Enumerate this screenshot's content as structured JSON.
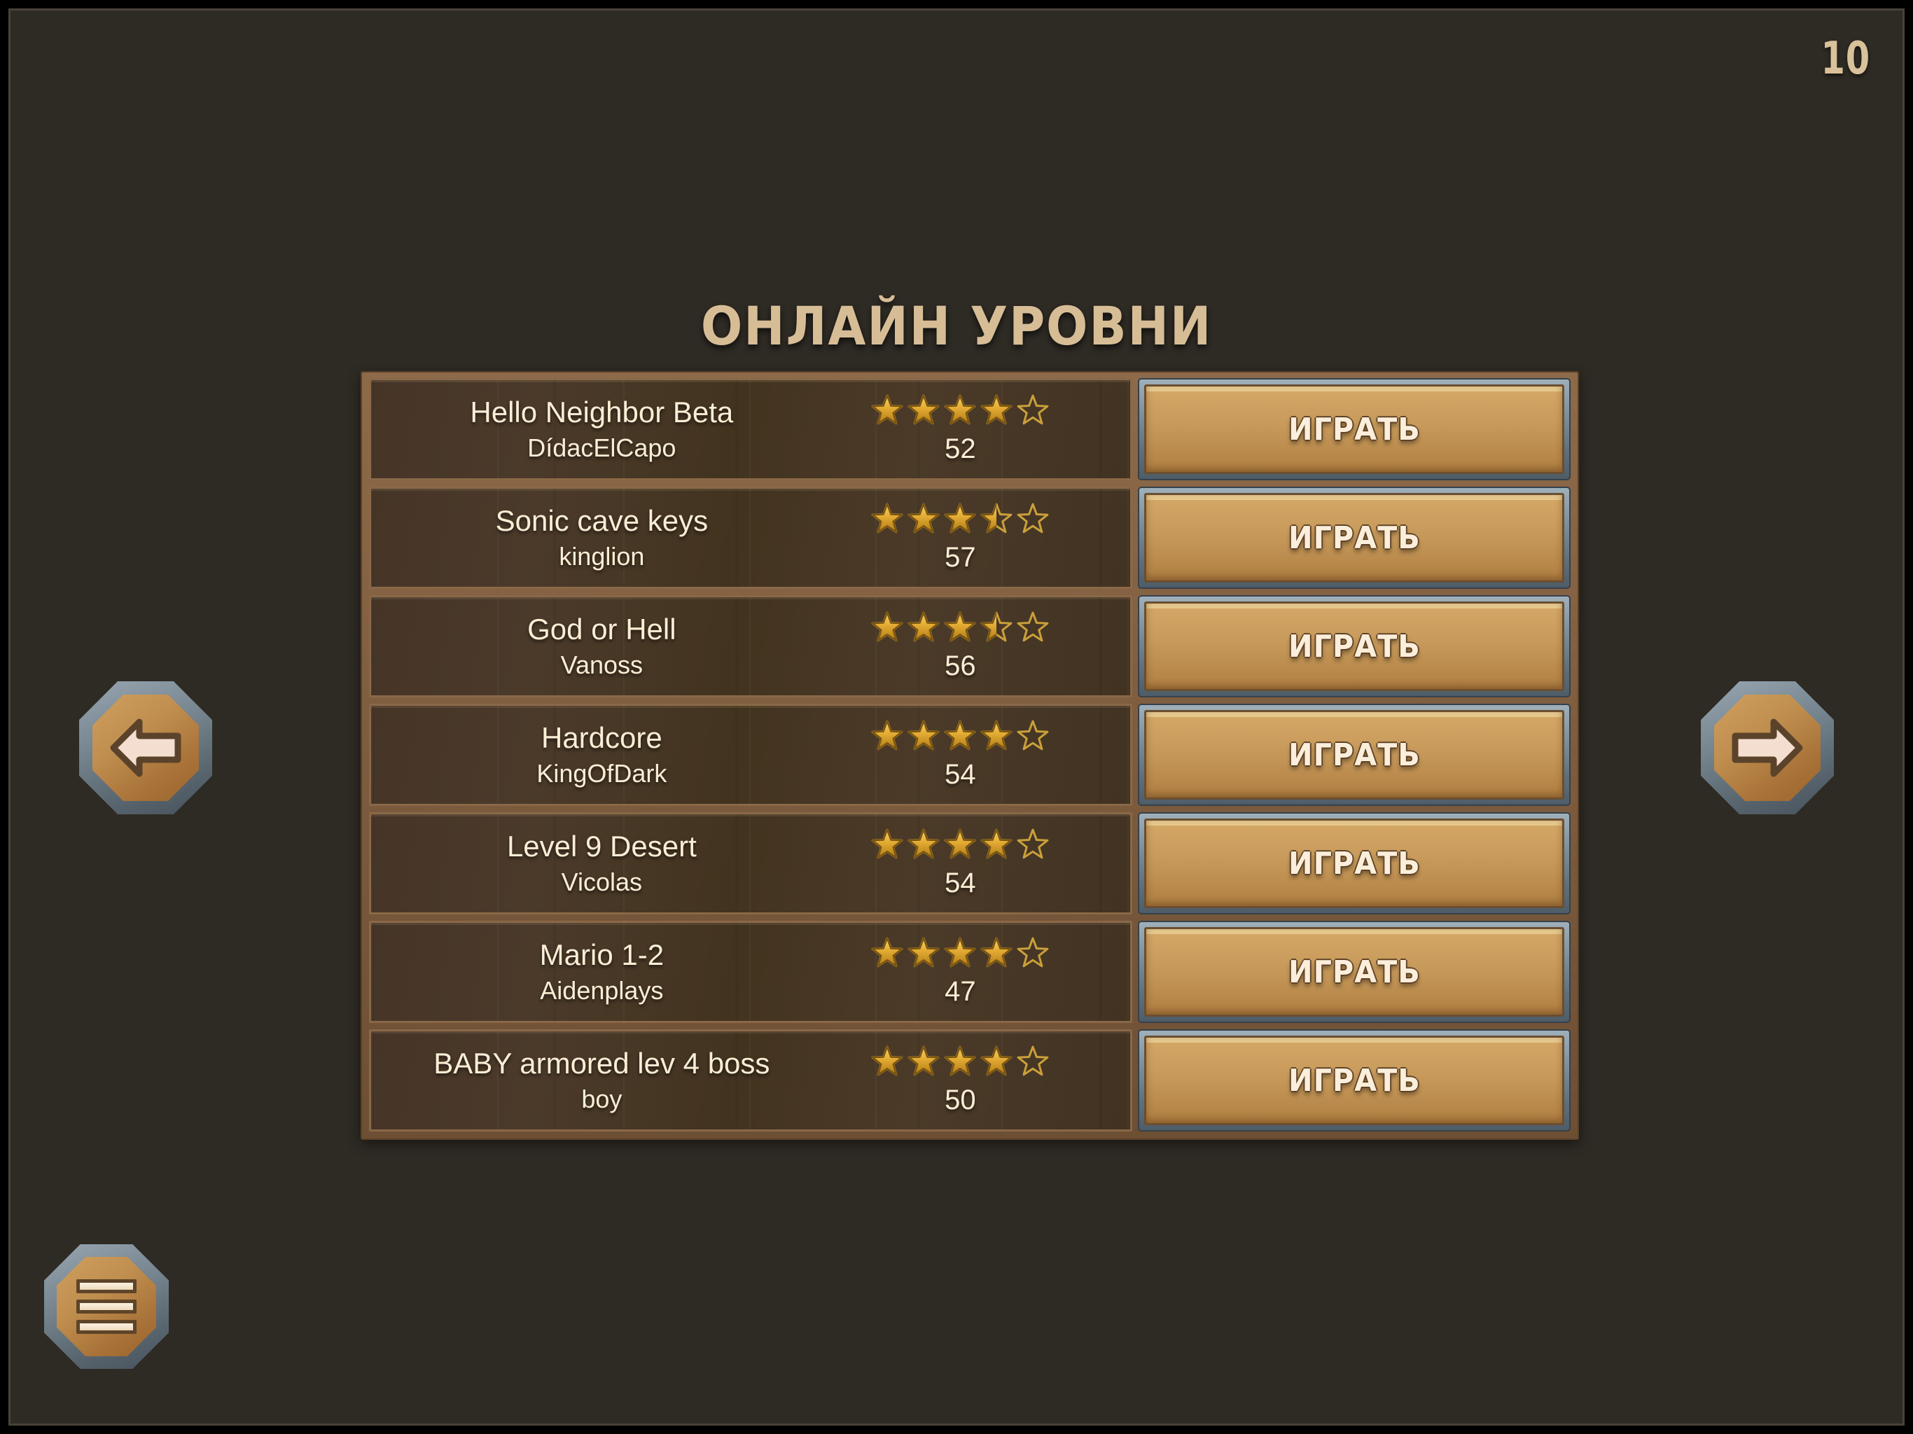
{
  "header": {
    "page_number": "10",
    "title": "ОНЛАЙН УРОВНИ"
  },
  "theme": {
    "background": "#2e2a24",
    "panel_border": "#8a6847",
    "row_background": "#453427",
    "text_cream": "#fbeed5",
    "title_tan": "#d7bd96",
    "star_gold": "#e8b53a",
    "button_wood": "#c79a5b",
    "button_bezel": "#76858f"
  },
  "nav": {
    "prev_label": "prev-page",
    "next_label": "next-page",
    "menu_label": "menu"
  },
  "list": {
    "play_label": "ИГРАТЬ",
    "rows": [
      {
        "level": "Hello Neighbor Beta",
        "author": "DídacElCapo",
        "stars": 4,
        "votes": "52"
      },
      {
        "level": "Sonic cave keys",
        "author": "kinglion",
        "stars": 3.5,
        "votes": "57"
      },
      {
        "level": "God or Hell",
        "author": "Vanoss",
        "stars": 3.5,
        "votes": "56"
      },
      {
        "level": "Hardcore",
        "author": "KingOfDark",
        "stars": 4,
        "votes": "54"
      },
      {
        "level": "Level 9 Desert",
        "author": "Vicolas",
        "stars": 4,
        "votes": "54"
      },
      {
        "level": "Mario 1-2",
        "author": "Aidenplays",
        "stars": 4,
        "votes": "47"
      },
      {
        "level": "BABY armored lev 4 boss",
        "author": "boy",
        "stars": 4,
        "votes": "50"
      }
    ]
  }
}
